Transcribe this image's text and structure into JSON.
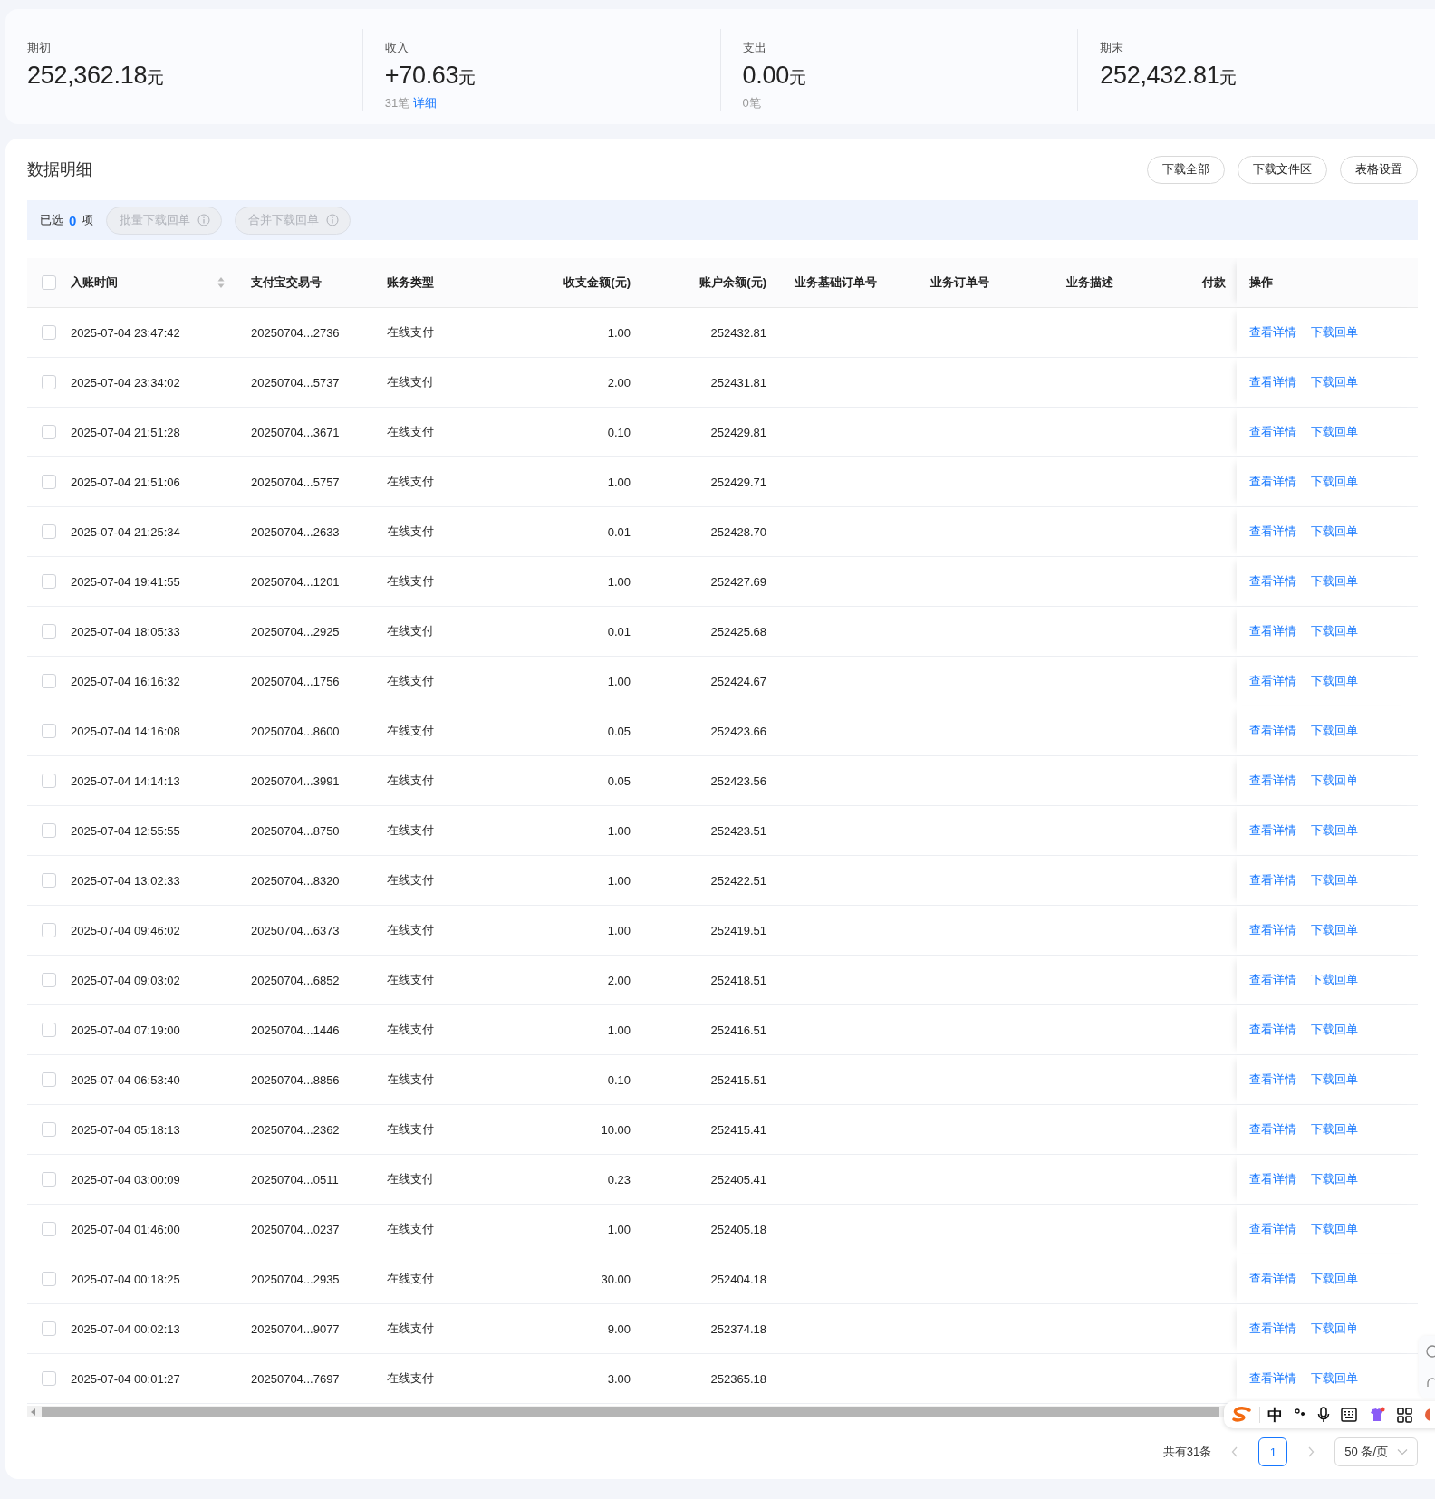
{
  "summary": [
    {
      "label": "期初",
      "value": "252,362.18",
      "unit": "元"
    },
    {
      "label": "收入",
      "value": "+70.63",
      "unit": "元",
      "count": "31笔",
      "link": "详细"
    },
    {
      "label": "支出",
      "value": "0.00",
      "unit": "元",
      "count": "0笔"
    },
    {
      "label": "期末",
      "value": "252,432.81",
      "unit": "元"
    }
  ],
  "detail": {
    "title": "数据明细",
    "buttons": [
      "下载全部",
      "下载文件区",
      "表格设置"
    ],
    "selection": {
      "prefix": "已选",
      "count": "0",
      "suffix": "项",
      "buttons": [
        {
          "label": "批量下载回单",
          "disabled": true
        },
        {
          "label": "合并下载回单",
          "disabled": true
        }
      ]
    },
    "table": {
      "all_checked": false,
      "columns": [
        {
          "label": "入账时间",
          "sortable": true,
          "kind": "text"
        },
        {
          "label": "支付宝交易号",
          "sortable": false,
          "kind": "text"
        },
        {
          "label": "账务类型",
          "sortable": false,
          "kind": "text"
        },
        {
          "label": "收支金额(元)",
          "sortable": false,
          "kind": "number"
        },
        {
          "label": "账户余额(元)",
          "sortable": false,
          "kind": "number"
        },
        {
          "label": "业务基础订单号",
          "sortable": false,
          "kind": "text"
        },
        {
          "label": "业务订单号",
          "sortable": false,
          "kind": "text"
        },
        {
          "label": "业务描述",
          "sortable": false,
          "kind": "text"
        },
        {
          "label": "付款",
          "sortable": false,
          "kind": "text"
        }
      ],
      "action_column": "操作",
      "rows": [
        {
          "checked": false,
          "cells": [
            "2025-07-04 23:47:42",
            "20250704...2736",
            "在线支付",
            "1.00",
            "252432.81"
          ],
          "actions": [
            "查看详情",
            "下载回单"
          ]
        },
        {
          "checked": false,
          "cells": [
            "2025-07-04 23:34:02",
            "20250704...5737",
            "在线支付",
            "2.00",
            "252431.81"
          ],
          "actions": [
            "查看详情",
            "下载回单"
          ]
        },
        {
          "checked": false,
          "cells": [
            "2025-07-04 21:51:28",
            "20250704...3671",
            "在线支付",
            "0.10",
            "252429.81"
          ],
          "actions": [
            "查看详情",
            "下载回单"
          ]
        },
        {
          "checked": false,
          "cells": [
            "2025-07-04 21:51:06",
            "20250704...5757",
            "在线支付",
            "1.00",
            "252429.71"
          ],
          "actions": [
            "查看详情",
            "下载回单"
          ]
        },
        {
          "checked": false,
          "cells": [
            "2025-07-04 21:25:34",
            "20250704...2633",
            "在线支付",
            "0.01",
            "252428.70"
          ],
          "actions": [
            "查看详情",
            "下载回单"
          ]
        },
        {
          "checked": false,
          "cells": [
            "2025-07-04 19:41:55",
            "20250704...1201",
            "在线支付",
            "1.00",
            "252427.69"
          ],
          "actions": [
            "查看详情",
            "下载回单"
          ]
        },
        {
          "checked": false,
          "cells": [
            "2025-07-04 18:05:33",
            "20250704...2925",
            "在线支付",
            "0.01",
            "252425.68"
          ],
          "actions": [
            "查看详情",
            "下载回单"
          ]
        },
        {
          "checked": false,
          "cells": [
            "2025-07-04 16:16:32",
            "20250704...1756",
            "在线支付",
            "1.00",
            "252424.67"
          ],
          "actions": [
            "查看详情",
            "下载回单"
          ]
        },
        {
          "checked": false,
          "cells": [
            "2025-07-04 14:16:08",
            "20250704...8600",
            "在线支付",
            "0.05",
            "252423.66"
          ],
          "actions": [
            "查看详情",
            "下载回单"
          ]
        },
        {
          "checked": false,
          "cells": [
            "2025-07-04 14:14:13",
            "20250704...3991",
            "在线支付",
            "0.05",
            "252423.56"
          ],
          "actions": [
            "查看详情",
            "下载回单"
          ]
        },
        {
          "checked": false,
          "cells": [
            "2025-07-04 12:55:55",
            "20250704...8750",
            "在线支付",
            "1.00",
            "252423.51"
          ],
          "actions": [
            "查看详情",
            "下载回单"
          ]
        },
        {
          "checked": false,
          "cells": [
            "2025-07-04 13:02:33",
            "20250704...8320",
            "在线支付",
            "1.00",
            "252422.51"
          ],
          "actions": [
            "查看详情",
            "下载回单"
          ]
        },
        {
          "checked": false,
          "cells": [
            "2025-07-04 09:46:02",
            "20250704...6373",
            "在线支付",
            "1.00",
            "252419.51"
          ],
          "actions": [
            "查看详情",
            "下载回单"
          ]
        },
        {
          "checked": false,
          "cells": [
            "2025-07-04 09:03:02",
            "20250704...6852",
            "在线支付",
            "2.00",
            "252418.51"
          ],
          "actions": [
            "查看详情",
            "下载回单"
          ]
        },
        {
          "checked": false,
          "cells": [
            "2025-07-04 07:19:00",
            "20250704...1446",
            "在线支付",
            "1.00",
            "252416.51"
          ],
          "actions": [
            "查看详情",
            "下载回单"
          ]
        },
        {
          "checked": false,
          "cells": [
            "2025-07-04 06:53:40",
            "20250704...8856",
            "在线支付",
            "0.10",
            "252415.51"
          ],
          "actions": [
            "查看详情",
            "下载回单"
          ]
        },
        {
          "checked": false,
          "cells": [
            "2025-07-04 05:18:13",
            "20250704...2362",
            "在线支付",
            "10.00",
            "252415.41"
          ],
          "actions": [
            "查看详情",
            "下载回单"
          ]
        },
        {
          "checked": false,
          "cells": [
            "2025-07-04 03:00:09",
            "20250704...0511",
            "在线支付",
            "0.23",
            "252405.41"
          ],
          "actions": [
            "查看详情",
            "下载回单"
          ]
        },
        {
          "checked": false,
          "cells": [
            "2025-07-04 01:46:00",
            "20250704...0237",
            "在线支付",
            "1.00",
            "252405.18"
          ],
          "actions": [
            "查看详情",
            "下载回单"
          ]
        },
        {
          "checked": false,
          "cells": [
            "2025-07-04 00:18:25",
            "20250704...2935",
            "在线支付",
            "30.00",
            "252404.18"
          ],
          "actions": [
            "查看详情",
            "下载回单"
          ]
        },
        {
          "checked": false,
          "cells": [
            "2025-07-04 00:02:13",
            "20250704...9077",
            "在线支付",
            "9.00",
            "252374.18"
          ],
          "actions": [
            "查看详情",
            "下载回单"
          ]
        },
        {
          "checked": false,
          "cells": [
            "2025-07-04 00:01:27",
            "20250704...7697",
            "在线支付",
            "3.00",
            "252365.18"
          ],
          "actions": [
            "查看详情",
            "下载回单"
          ]
        }
      ]
    },
    "pagination": {
      "total": "共有31条",
      "pages": [
        {
          "label": "1",
          "selected": true
        }
      ],
      "page_size": "50 条/页"
    }
  },
  "ime_toolbar": {
    "mode": "中"
  }
}
